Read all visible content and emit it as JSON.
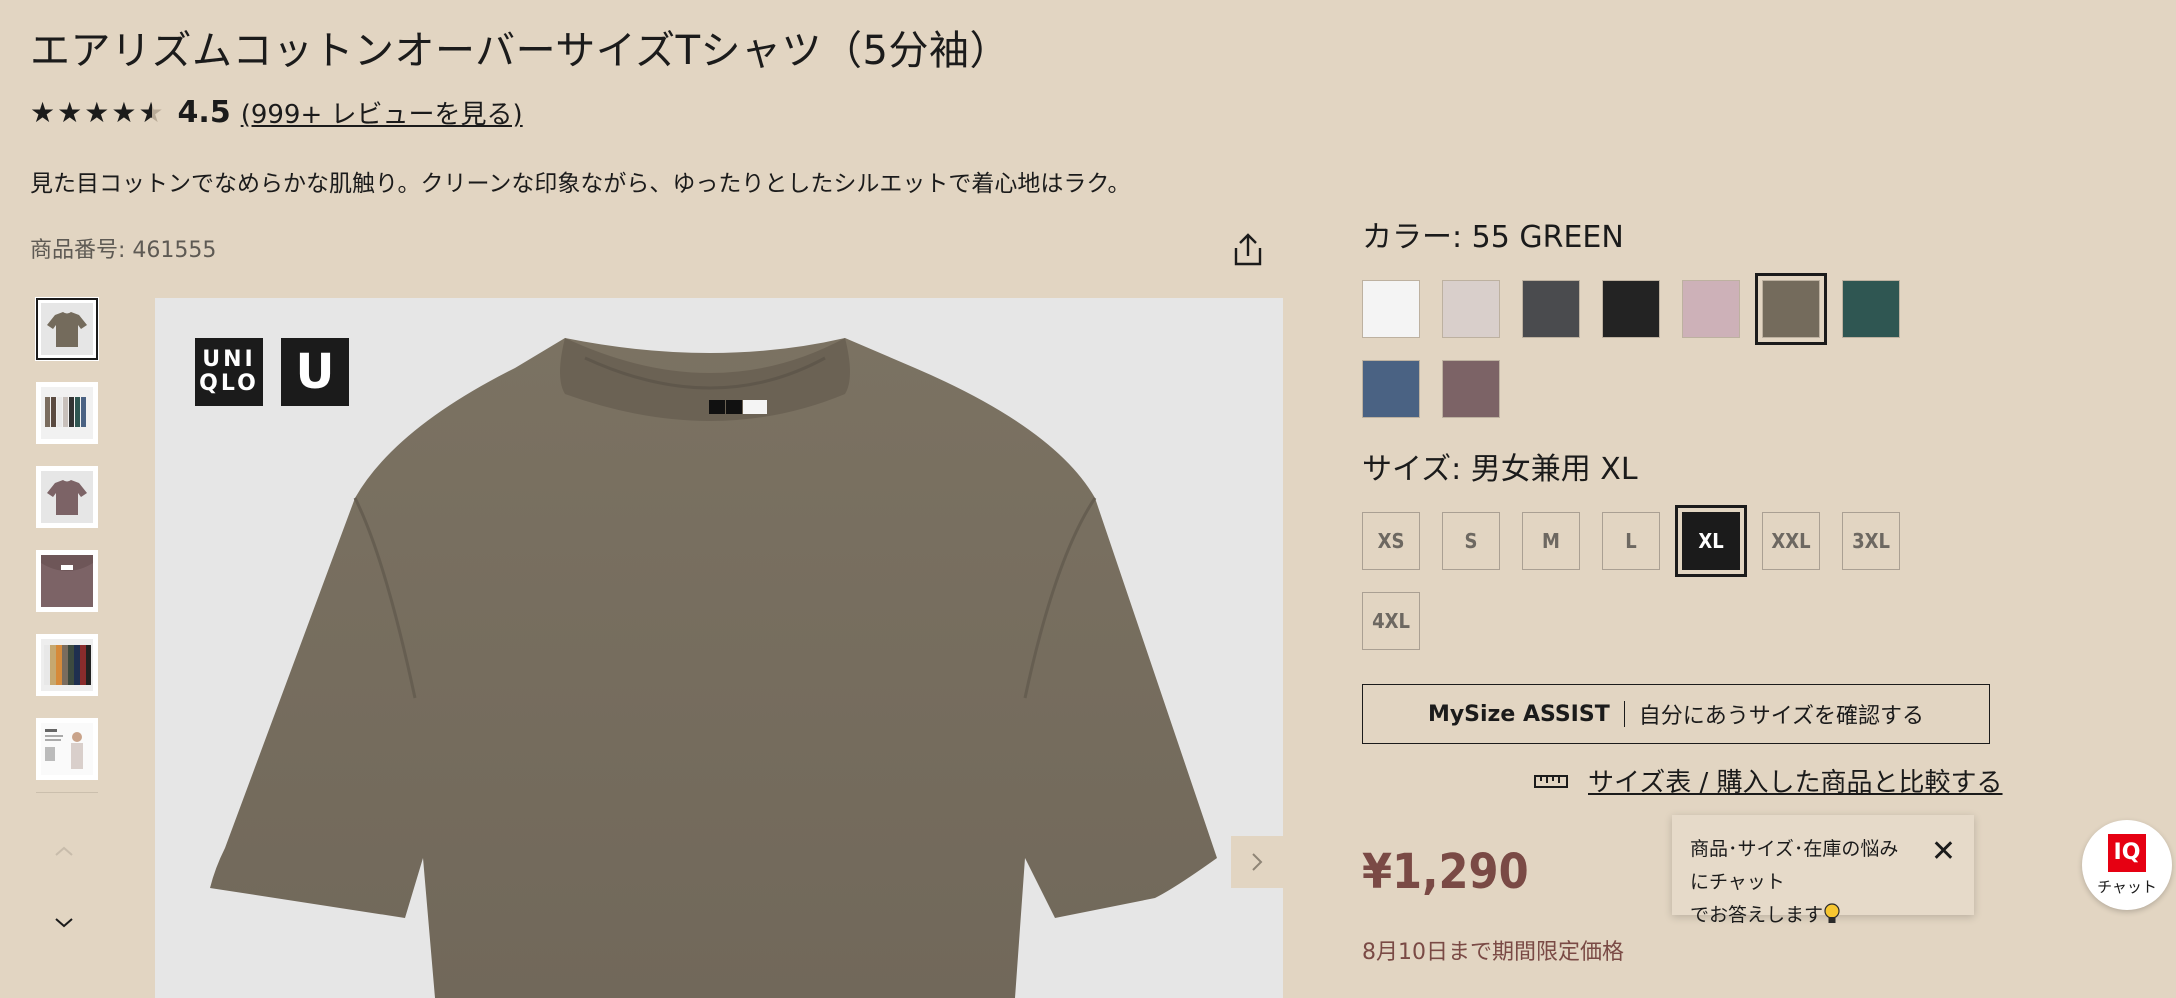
{
  "product": {
    "title": "エアリズムコットンオーバーサイズTシャツ（5分袖）",
    "rating_value": "4.5",
    "rating_stars": 4.5,
    "review_link": "(999+ レビューを見る)",
    "description": "見た目コットンでなめらかな肌触り。クリーンな印象ながら、ゆったりとしたシルエットで着心地はラク。",
    "product_number": "商品番号: 461555"
  },
  "gallery": {
    "logo_uniqlo_line1": "UNI",
    "logo_uniqlo_line2": "QLO",
    "logo_u": "U",
    "thumbnails": [
      "thumb-green-tee",
      "thumb-rack-lineup",
      "thumb-mauve-tee",
      "thumb-mauve-closeup",
      "thumb-colors-stack",
      "thumb-model-info"
    ]
  },
  "color": {
    "label": "カラー:  55 GREEN",
    "swatches": [
      "#f4f4f4",
      "#d9cfcb",
      "#4a4b4e",
      "#232323",
      "#cdb1b8",
      "#746b5c",
      "#2f5652",
      "#4a6283",
      "#7c6366"
    ],
    "selected_index": 5
  },
  "size": {
    "label": "サイズ:  男女兼用 XL",
    "options": [
      "XS",
      "S",
      "M",
      "L",
      "XL",
      "XXL",
      "3XL",
      "4XL"
    ],
    "selected_index": 4
  },
  "mysize": {
    "brand": "MySize ASSIST",
    "text": "自分にあうサイズを確認する"
  },
  "size_chart_link": "サイズ表 / 購入した商品と比較する",
  "price": "¥1,290",
  "price_note": "8月10日まで期間限定価格",
  "chat": {
    "bubble_line1": "商品･サイズ･在庫の悩みにチャット",
    "bubble_line2": "でお答えします",
    "iq": "IQ",
    "button_label": "チャット"
  },
  "colors": {
    "background": "#e2d5c2",
    "price": "#7a4a45",
    "text": "#1b1b1b",
    "brand_red": "#e60012"
  }
}
